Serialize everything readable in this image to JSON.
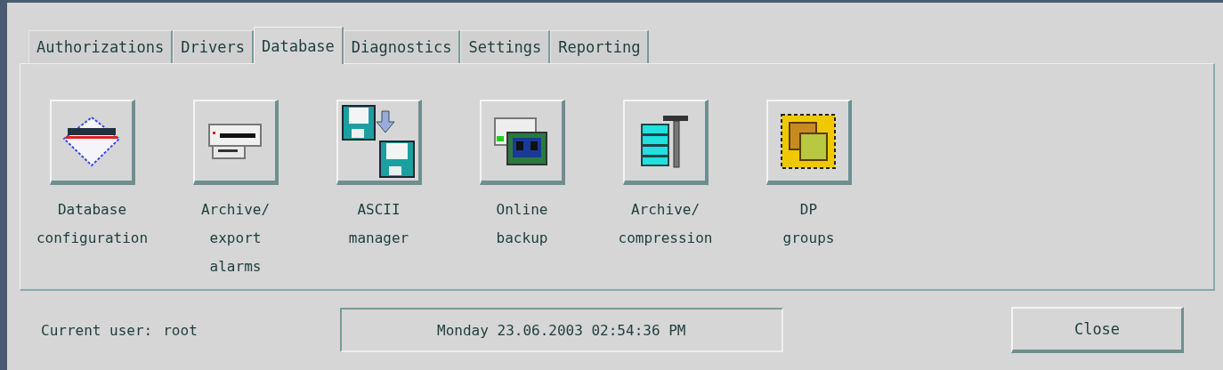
{
  "tabs": [
    {
      "label": "Authorizations",
      "selected": false
    },
    {
      "label": "Drivers",
      "selected": false
    },
    {
      "label": "Database",
      "selected": true
    },
    {
      "label": "Diagnostics",
      "selected": false
    },
    {
      "label": "Settings",
      "selected": false
    },
    {
      "label": "Reporting",
      "selected": false
    }
  ],
  "tools": [
    {
      "kind": "database",
      "label": [
        "Database",
        "configuration"
      ]
    },
    {
      "kind": "archive",
      "label": [
        "Archive/",
        "export",
        "alarms"
      ]
    },
    {
      "kind": "ascii",
      "label": [
        "ASCII",
        "manager"
      ]
    },
    {
      "kind": "backup",
      "label": [
        "Online",
        "backup"
      ]
    },
    {
      "kind": "compression",
      "label": [
        "Archive/",
        "compression"
      ]
    },
    {
      "kind": "dpgroups",
      "label": [
        "DP",
        "groups"
      ]
    }
  ],
  "status": {
    "user_label": "Current user:",
    "user": "root",
    "datetime": "Monday 23.06.2003 02:54:36 PM"
  },
  "buttons": [
    "Close"
  ]
}
